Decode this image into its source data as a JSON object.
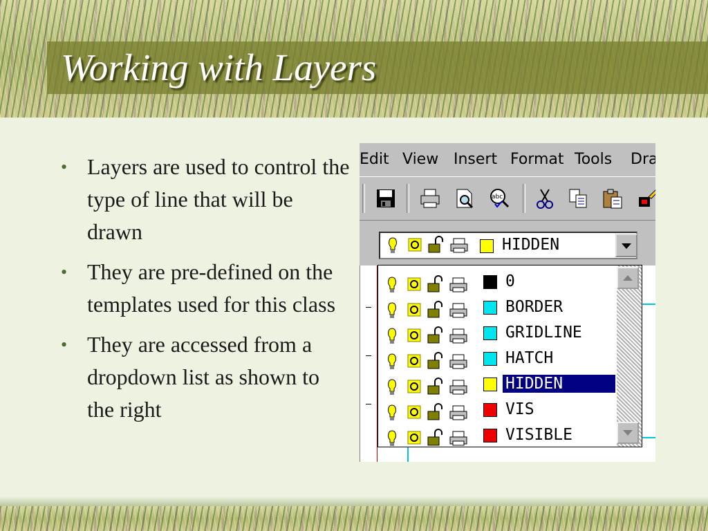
{
  "slide": {
    "title": "Working with Layers",
    "bullets": [
      "Layers are used to control the type of line that will be drawn",
      "They are pre-defined on the templates used for this class",
      "They are accessed from a dropdown list as shown to the right"
    ]
  },
  "app": {
    "menu": [
      "Edit",
      "View",
      "Insert",
      "Format",
      "Tools",
      "Dra"
    ],
    "toolbar_icons": [
      "save-icon",
      "print-icon",
      "print-preview-icon",
      "spell-check-icon",
      "cut-icon",
      "copy-icon",
      "paste-icon",
      "match-properties-icon"
    ],
    "layer_combo": {
      "current": "HIDDEN",
      "current_color": "#ffff00"
    },
    "layers": [
      {
        "name": "0",
        "color": "#000000",
        "selected": false
      },
      {
        "name": "BORDER",
        "color": "#00e5ee",
        "selected": false
      },
      {
        "name": "GRIDLINE",
        "color": "#00e5ee",
        "selected": false
      },
      {
        "name": "HATCH",
        "color": "#00e5ee",
        "selected": false
      },
      {
        "name": "HIDDEN",
        "color": "#ffff00",
        "selected": true
      },
      {
        "name": "VIS",
        "color": "#ee0000",
        "selected": false
      },
      {
        "name": "VISIBLE",
        "color": "#ee0000",
        "selected": false
      }
    ]
  }
}
